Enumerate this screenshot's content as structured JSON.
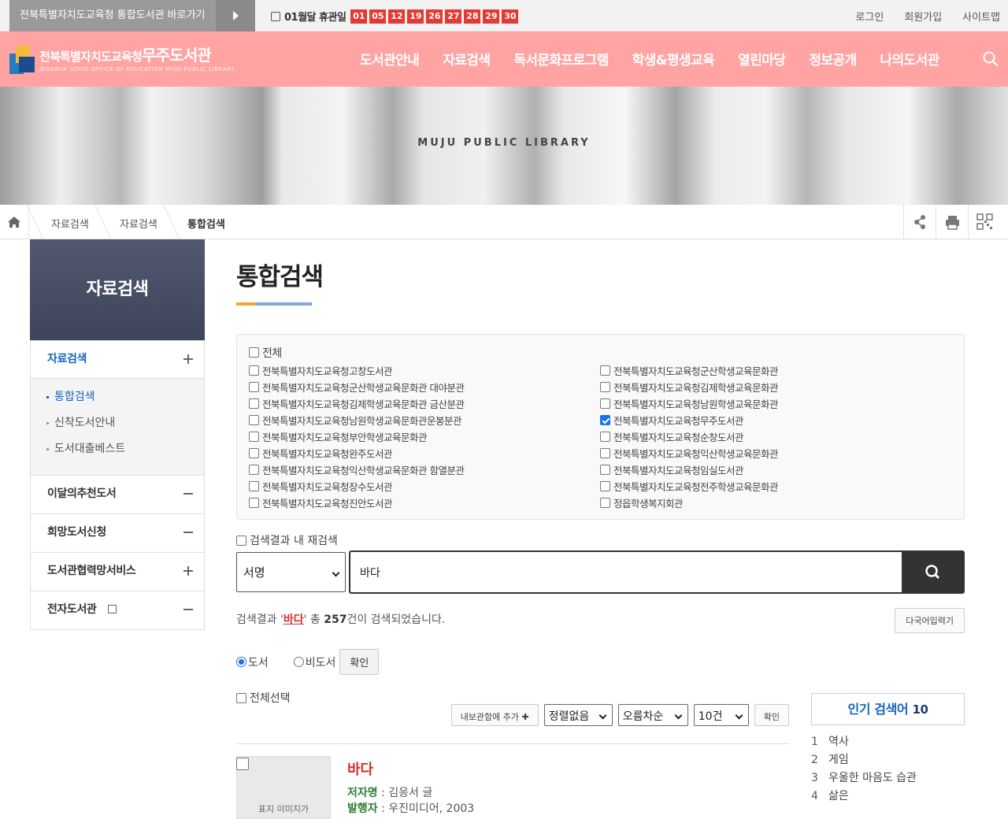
{
  "topbar": {
    "portal_link": "전북특별자치도교육청 통합도서관 바로가기",
    "closed_label": "01월달 휴관일",
    "closed_days": [
      "01",
      "05",
      "12",
      "19",
      "26",
      "27",
      "28",
      "29",
      "30"
    ],
    "util": [
      "로그인",
      "회원가입",
      "사이트맵"
    ]
  },
  "header": {
    "logo_prefix": "전북특별자치도교육청",
    "logo_name": "무주도서관",
    "logo_sub": "JEONBUK STATE OFFICE OF EDUCATION MUJU PUBLIC LIBRARY",
    "menu": [
      "도서관안내",
      "자료검색",
      "독서문화프로그램",
      "학생&평생교육",
      "열린마당",
      "정보공개",
      "나의도서관"
    ]
  },
  "banner": {
    "text": "MUJU PUBLIC LIBRARY"
  },
  "breadcrumb": [
    "자료검색",
    "자료검색",
    "통합검색"
  ],
  "sidebar": {
    "title": "자료검색",
    "items": [
      {
        "label": "자료검색",
        "sub": [
          "통합검색",
          "신착도서안내",
          "도서대출베스트"
        ]
      },
      {
        "label": "이달의추천도서"
      },
      {
        "label": "희망도서신청"
      },
      {
        "label": "도서관협력망서비스"
      },
      {
        "label": "전자도서관"
      }
    ]
  },
  "main": {
    "title": "통합검색",
    "all_label": "전체",
    "libraries_left": [
      "전북특별자치도교육청고창도서관",
      "전북특별자치도교육청군산학생교육문화관 대야분관",
      "전북특별자치도교육청김제학생교육문화관 금산분관",
      "전북특별자치도교육청남원학생교육문화관운봉분관",
      "전북특별자치도교육청부안학생교육문화관",
      "전북특별자치도교육청완주도서관",
      "전북특별자치도교육청익산학생교육문화관 함열분관",
      "전북특별자치도교육청장수도서관",
      "전북특별자치도교육청진안도서관"
    ],
    "libraries_right": [
      "전북특별자치도교육청군산학생교육문화관",
      "전북특별자치도교육청김제학생교육문화관",
      "전북특별자치도교육청남원학생교육문화관",
      "전북특별자치도교육청무주도서관",
      "전북특별자치도교육청순창도서관",
      "전북특별자치도교육청익산학생교육문화관",
      "전북특별자치도교육청임실도서관",
      "전북특별자치도교육청전주학생교육문화관",
      "정읍학생복지회관"
    ],
    "re_search_label": "검색결과 내 재검색",
    "search_field": "서명",
    "search_value": "바다",
    "result_prefix": "검색결과 '",
    "result_keyword": "바다",
    "result_mid": "' 총 ",
    "result_count": "257",
    "result_suffix": "건이 검색되었습니다.",
    "multi_lang_button": "다국어입력기",
    "radio_book": "도서",
    "radio_nonbook": "비도서",
    "confirm": "확인",
    "select_all": "전체선택",
    "add_to_shelf": "내보관함에 추가 ✚",
    "sort": "정렬없음",
    "order": "오름차순",
    "per_page": "10건",
    "confirm2": "확인"
  },
  "result_item": {
    "thumb_text": "표지 이미지가",
    "title": "바다",
    "author_label": "저자명",
    "author": " : 김응서 글",
    "publisher_label": "발행자",
    "publisher": " : 우진미디어, 2003"
  },
  "popular": {
    "title": "인기 검색어",
    "count": "10",
    "items": [
      "역사",
      "게임",
      "우울한 마음도 습관",
      "삶은"
    ]
  }
}
